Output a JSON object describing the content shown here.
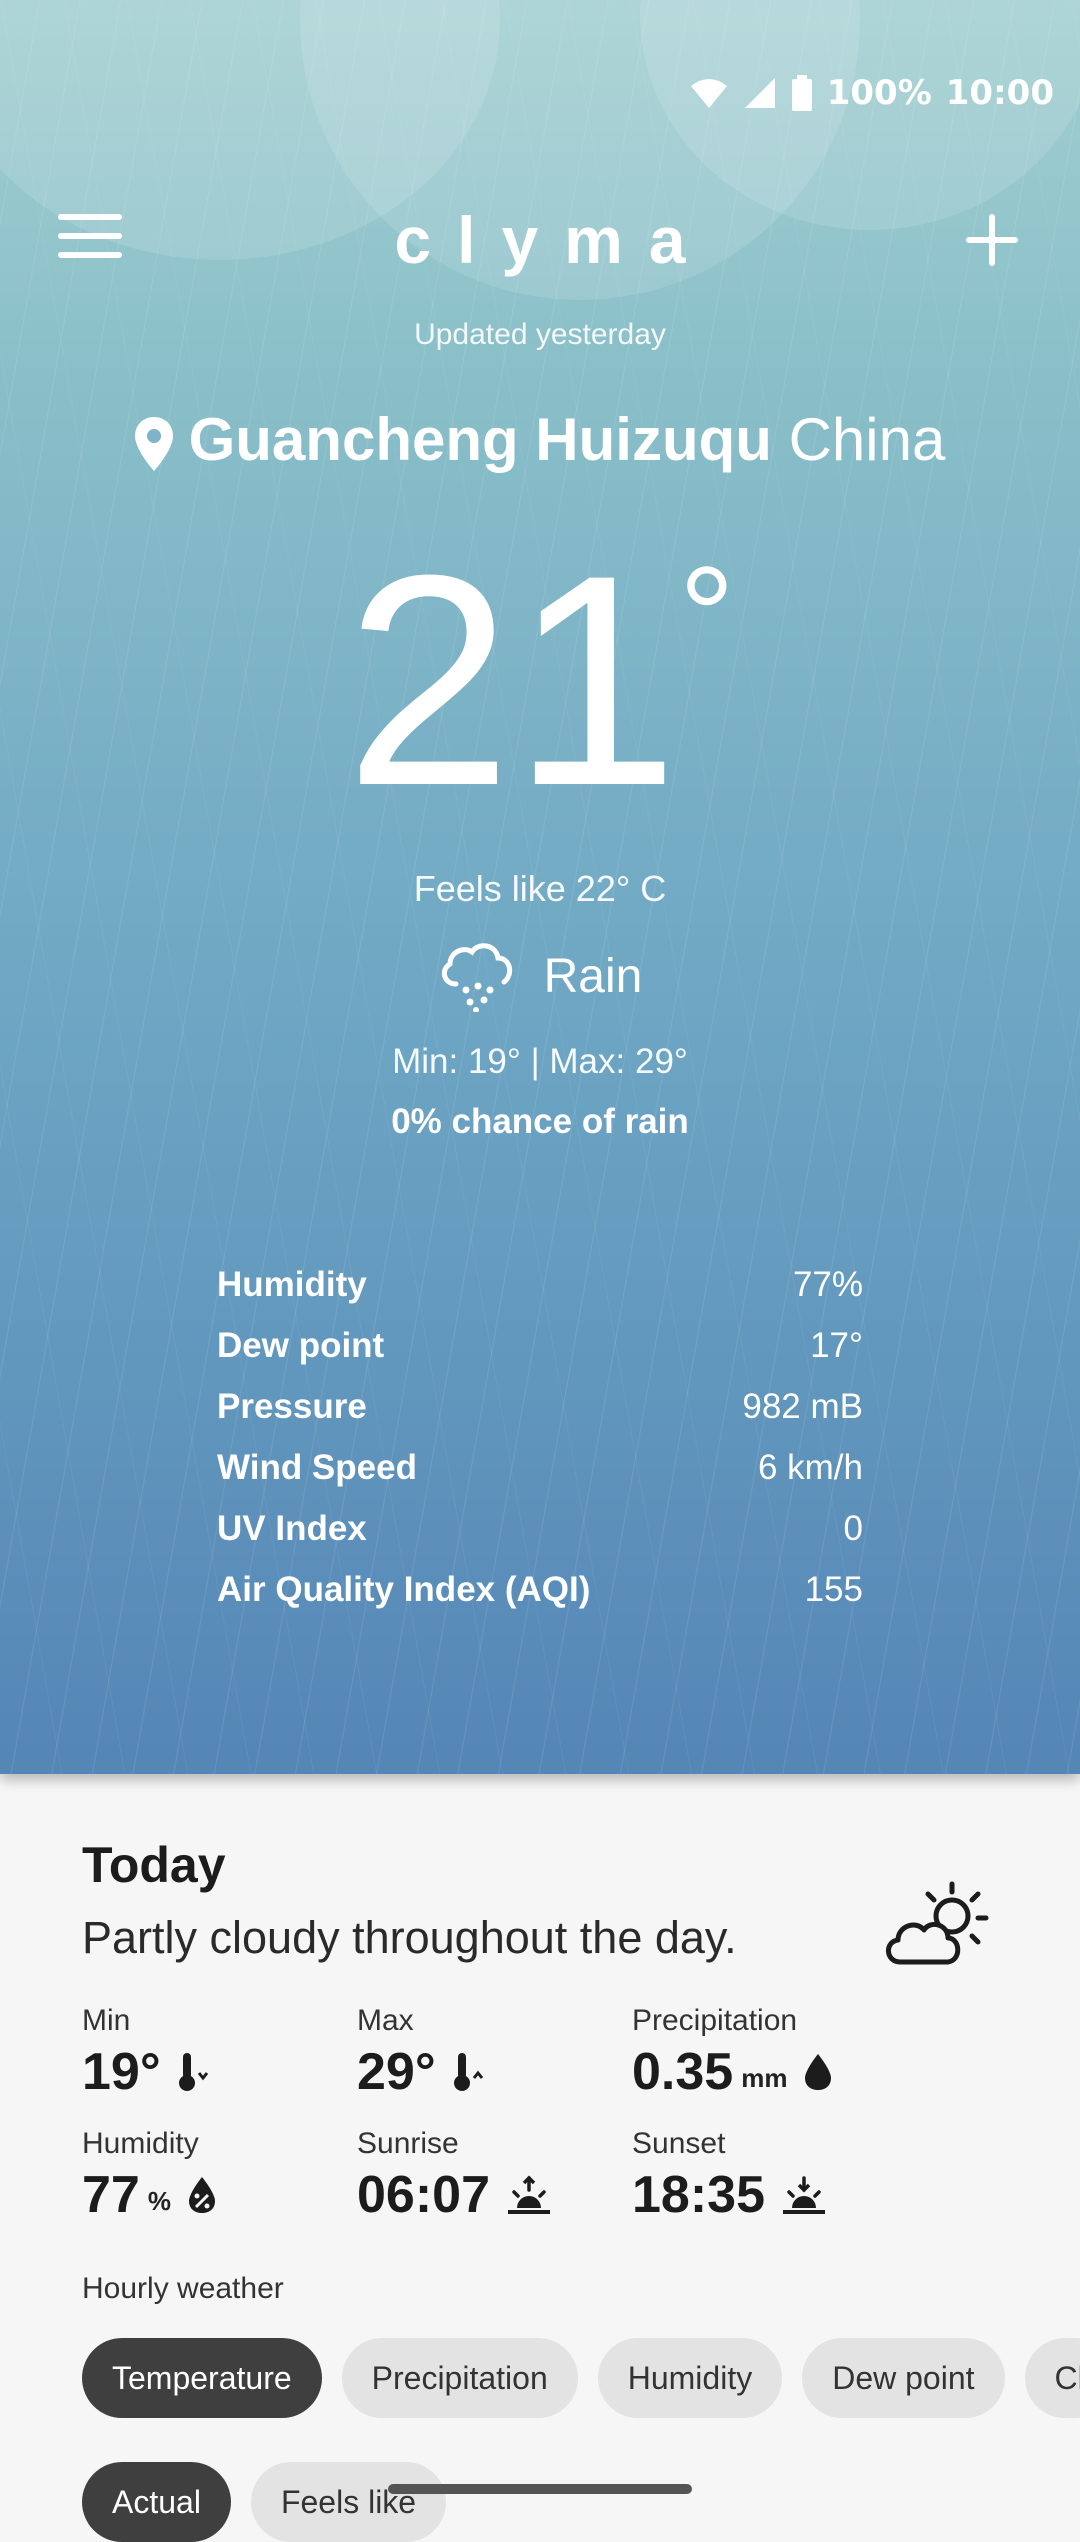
{
  "status_bar": {
    "battery": "100%",
    "time": "10:00"
  },
  "header": {
    "app_name": "clyma",
    "updated": "Updated yesterday"
  },
  "location": {
    "city": "Guancheng Huizuqu",
    "country": "China"
  },
  "current": {
    "temperature": "21",
    "degree_symbol": "°",
    "feels_like": "Feels like 22° C",
    "condition": "Rain",
    "condition_icon": "rain-cloud-icon",
    "min_max": "Min: 19° | Max: 29°",
    "rain_chance": "0% chance of rain"
  },
  "details": [
    {
      "label": "Humidity",
      "value": "77%"
    },
    {
      "label": "Dew point",
      "value": "17°"
    },
    {
      "label": "Pressure",
      "value": "982 mB"
    },
    {
      "label": "Wind Speed",
      "value": "6 km/h"
    },
    {
      "label": "UV Index",
      "value": "0"
    },
    {
      "label": "Air Quality Index (AQI)",
      "value": "155"
    }
  ],
  "today": {
    "title": "Today",
    "summary": "Partly cloudy throughout the day.",
    "icon": "partly-cloudy-icon",
    "stats": {
      "min": {
        "label": "Min",
        "value": "19°"
      },
      "max": {
        "label": "Max",
        "value": "29°"
      },
      "precipitation": {
        "label": "Precipitation",
        "value": "0.35",
        "unit": "mm"
      },
      "humidity": {
        "label": "Humidity",
        "value": "77",
        "unit": "%"
      },
      "sunrise": {
        "label": "Sunrise",
        "value": "06:07"
      },
      "sunset": {
        "label": "Sunset",
        "value": "18:35"
      }
    }
  },
  "hourly": {
    "title": "Hourly weather",
    "metric_chips": [
      "Temperature",
      "Precipitation",
      "Humidity",
      "Dew point",
      "Cl"
    ],
    "active_metric": "Temperature",
    "mode_chips": [
      "Actual",
      "Feels like"
    ],
    "active_mode": "Actual"
  },
  "colors": {
    "hero_top": "#a3cfd1",
    "hero_bottom": "#5486b6",
    "chip_active": "#3f3f3f",
    "chip_inactive": "#e3e3e3"
  }
}
